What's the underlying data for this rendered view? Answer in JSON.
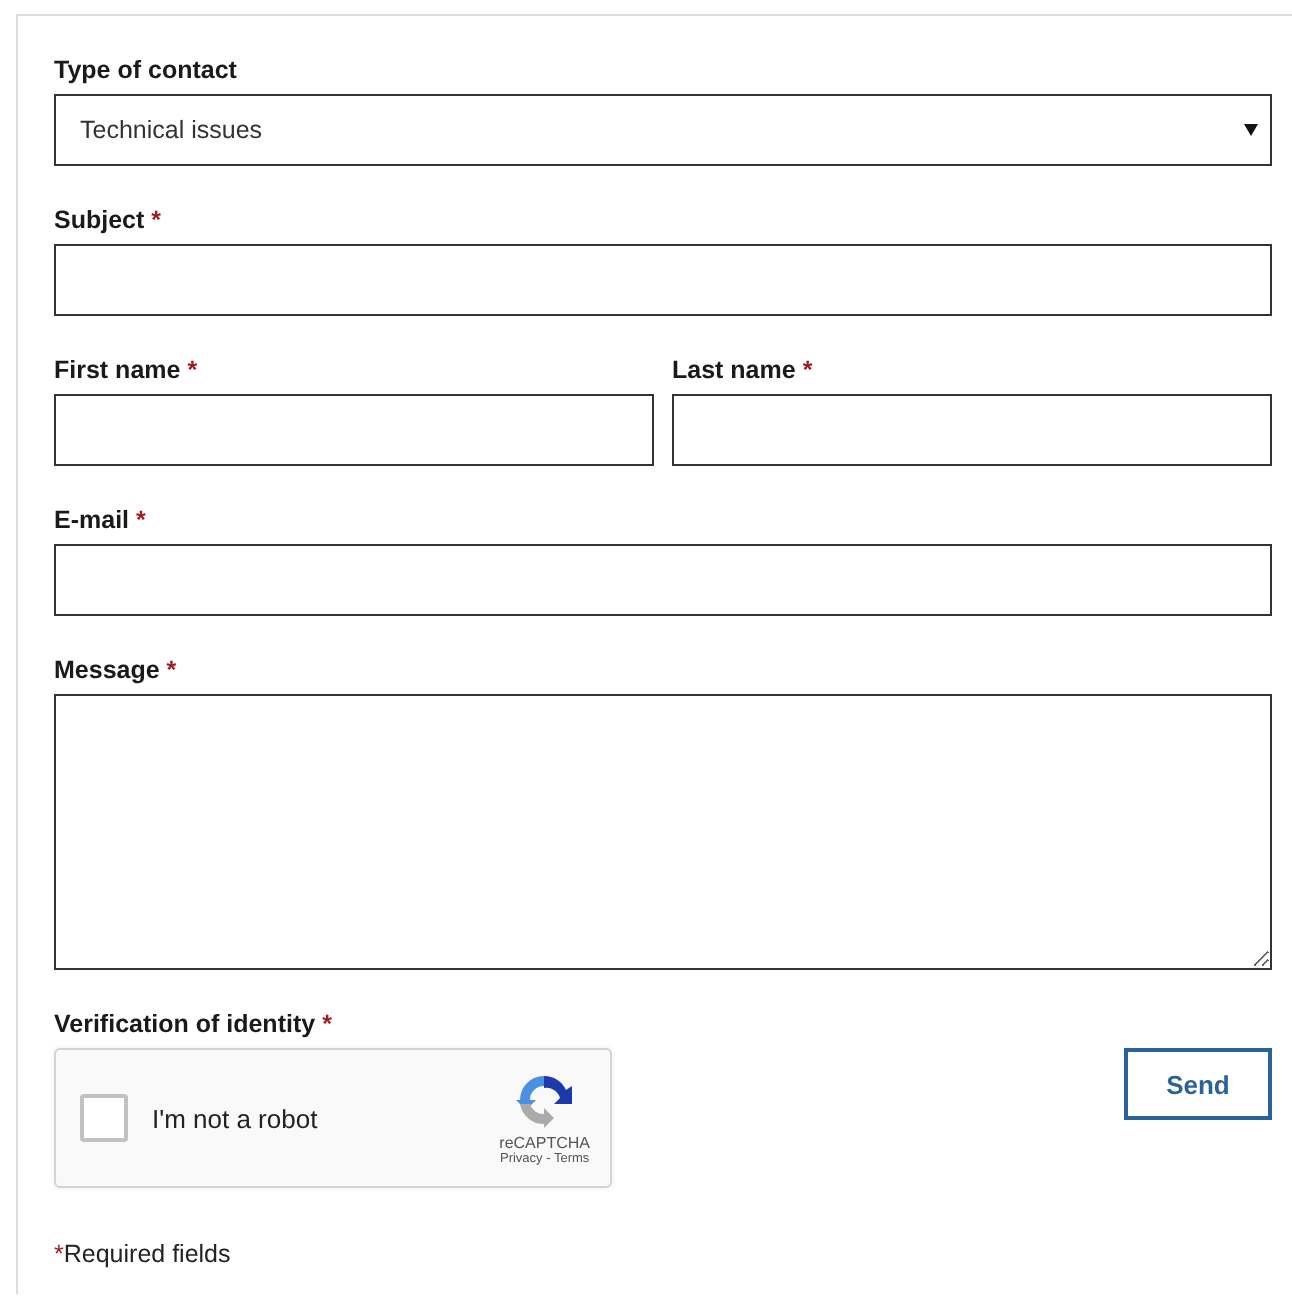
{
  "form": {
    "rows": [
      {
        "fields": [
          {
            "kind": "select",
            "label": "Type of contact",
            "value": "Technical issues"
          }
        ]
      },
      {
        "fields": [
          {
            "kind": "text",
            "label": "Subject",
            "required_mark": "*"
          }
        ]
      },
      {
        "fields": [
          {
            "kind": "text",
            "label": "First name",
            "required_mark": "*"
          },
          {
            "kind": "text",
            "label": "Last name",
            "required_mark": "*"
          }
        ]
      },
      {
        "fields": [
          {
            "kind": "text",
            "label": "E-mail",
            "required_mark": "*"
          }
        ]
      },
      {
        "fields": [
          {
            "kind": "textarea",
            "label": "Message",
            "required_mark": "*"
          }
        ]
      }
    ],
    "verification": {
      "label": "Verification of identity",
      "required_mark": "*",
      "captcha": {
        "checked": false,
        "text": "I'm not a robot",
        "brand": "reCAPTCHA",
        "links": "Privacy - Terms"
      }
    },
    "send_button": "Send",
    "note": {
      "mark": "*",
      "text": "Required fields"
    }
  }
}
